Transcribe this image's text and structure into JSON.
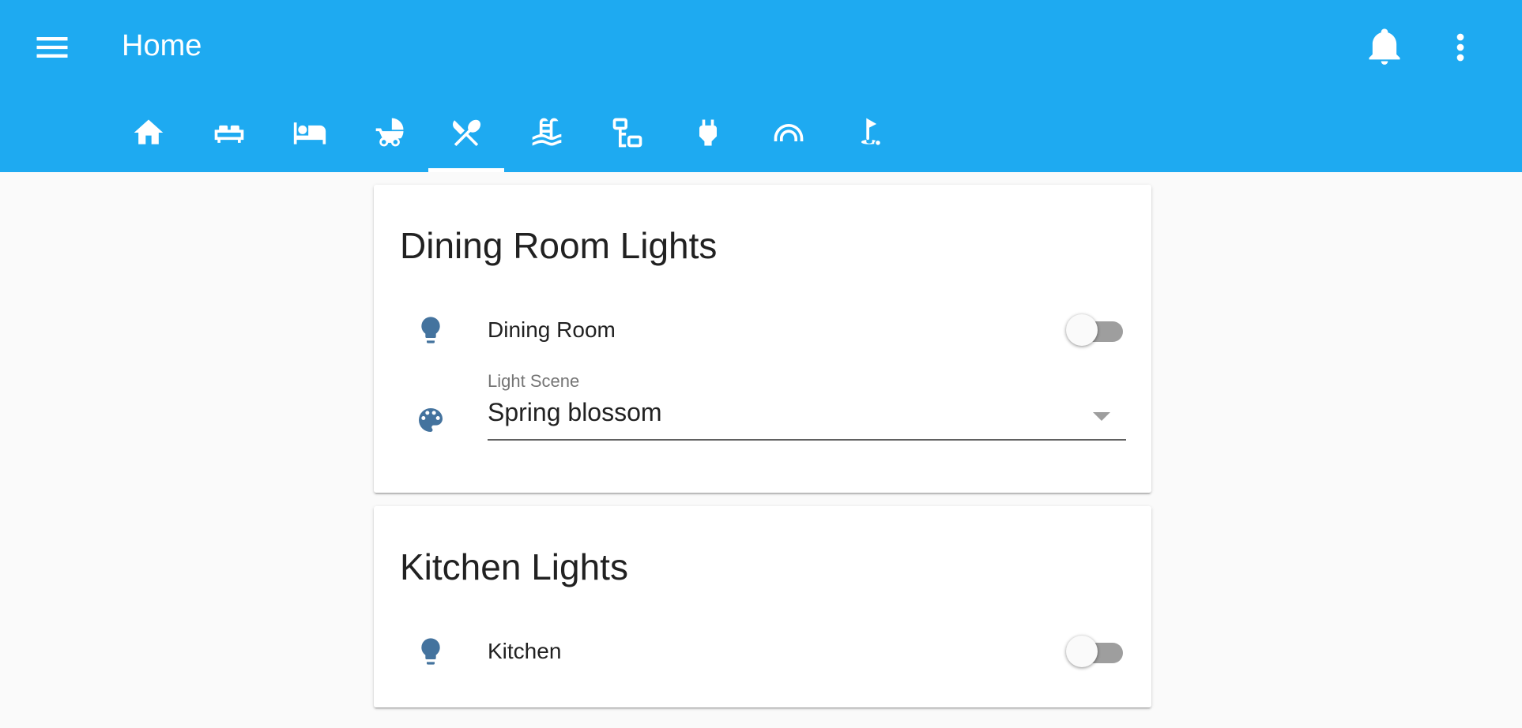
{
  "header": {
    "title": "Home",
    "menu_icon": "menu-icon",
    "notifications_icon": "bell-icon",
    "more_icon": "dots-vertical-icon"
  },
  "tabs": [
    {
      "icon": "home-icon",
      "active": false
    },
    {
      "icon": "sofa-icon",
      "active": false
    },
    {
      "icon": "bed-icon",
      "active": false
    },
    {
      "icon": "baby-carriage-icon",
      "active": false
    },
    {
      "icon": "silverware-icon",
      "active": true
    },
    {
      "icon": "pool-icon",
      "active": false
    },
    {
      "icon": "network-icon",
      "active": false
    },
    {
      "icon": "power-plug-icon",
      "active": false
    },
    {
      "icon": "rainbow-icon",
      "active": false
    },
    {
      "icon": "golf-icon",
      "active": false
    }
  ],
  "cards": [
    {
      "title": "Dining Room Lights",
      "entities": [
        {
          "icon": "lightbulb-icon",
          "name": "Dining Room",
          "state": "off"
        }
      ],
      "select": {
        "icon": "palette-icon",
        "label": "Light Scene",
        "value": "Spring blossom"
      }
    },
    {
      "title": "Kitchen Lights",
      "entities": [
        {
          "icon": "lightbulb-icon",
          "name": "Kitchen",
          "state": "off"
        }
      ]
    }
  ],
  "colors": {
    "header": "#1eaaf1",
    "icon": "#44739e",
    "toggle_off_track": "#9e9e9e",
    "background": "#fafafa"
  }
}
